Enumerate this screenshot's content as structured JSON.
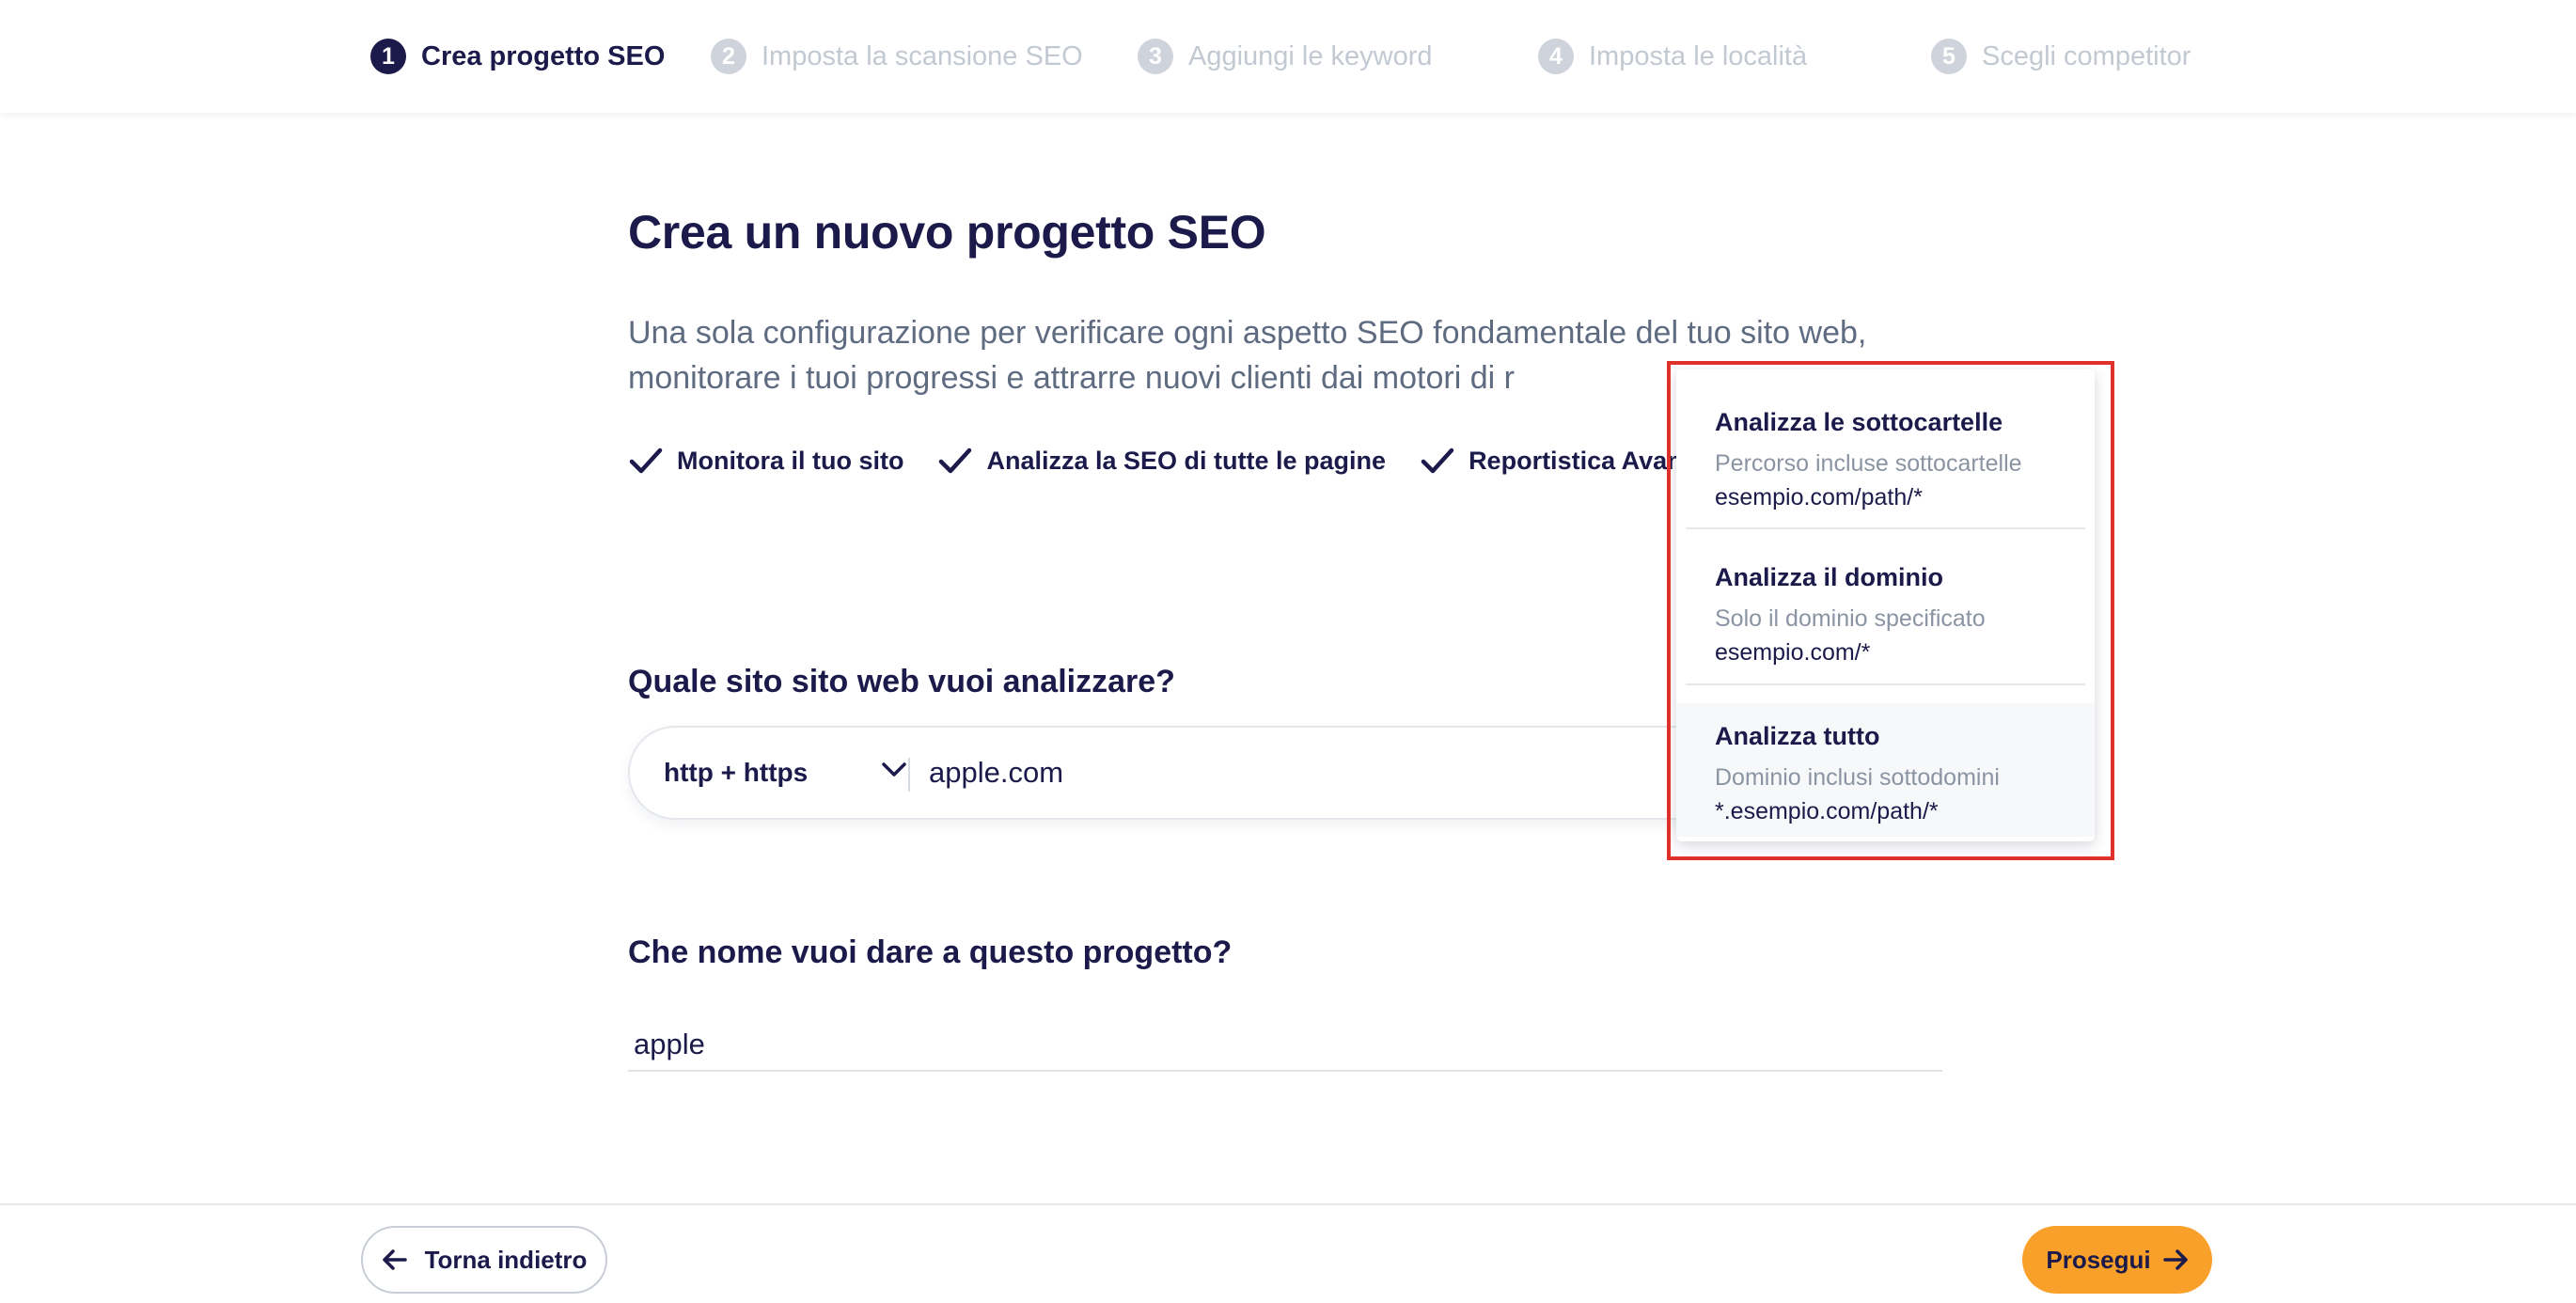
{
  "stepper": {
    "steps": [
      {
        "number": "1",
        "label": "Crea progetto SEO",
        "active": true
      },
      {
        "number": "2",
        "label": "Imposta la scansione SEO",
        "active": false
      },
      {
        "number": "3",
        "label": "Aggiungi le keyword",
        "active": false
      },
      {
        "number": "4",
        "label": "Imposta le località",
        "active": false
      },
      {
        "number": "5",
        "label": "Scegli competitor",
        "active": false
      }
    ]
  },
  "main": {
    "title": "Crea un nuovo progetto SEO",
    "description": "Una sola configurazione per verificare ogni aspetto SEO fondamentale del tuo sito web, monitorare i tuoi progressi e attrarre nuovi clienti dai motori di r",
    "features": [
      {
        "label": "Monitora il tuo sito",
        "icon": "check-icon"
      },
      {
        "label": "Analizza la SEO di tutte le pagine",
        "icon": "check-icon"
      },
      {
        "label": "Reportistica Avanzata",
        "icon": "check-icon"
      }
    ],
    "site_question": "Quale sito sito web vuoi analizzare?",
    "protocol": {
      "selected": "http + https",
      "icon": "chevron-down-icon"
    },
    "url_value": "apple.com",
    "name_question": "Che nome vuoi dare a questo progetto?",
    "name_value": "apple"
  },
  "dropdown": {
    "items": [
      {
        "title": "Analizza le sottocartelle",
        "subtitle": "Percorso incluse sottocartelle",
        "path": "esempio.com/path/*"
      },
      {
        "title": "Analizza il dominio",
        "subtitle": "Solo il dominio specificato",
        "path": "esempio.com/*"
      },
      {
        "title": "Analizza tutto",
        "subtitle": "Dominio inclusi sottodomini",
        "path": "*.esempio.com/path/*"
      }
    ],
    "highlight_color": "#e0302a"
  },
  "footer": {
    "back_label": "Torna indietro",
    "next_label": "Prosegui",
    "next_color": "#f9a02a"
  },
  "colors": {
    "primary_text": "#1b1a4a",
    "muted_text": "#5f6b80",
    "inactive_step": "#c3c9d2"
  }
}
